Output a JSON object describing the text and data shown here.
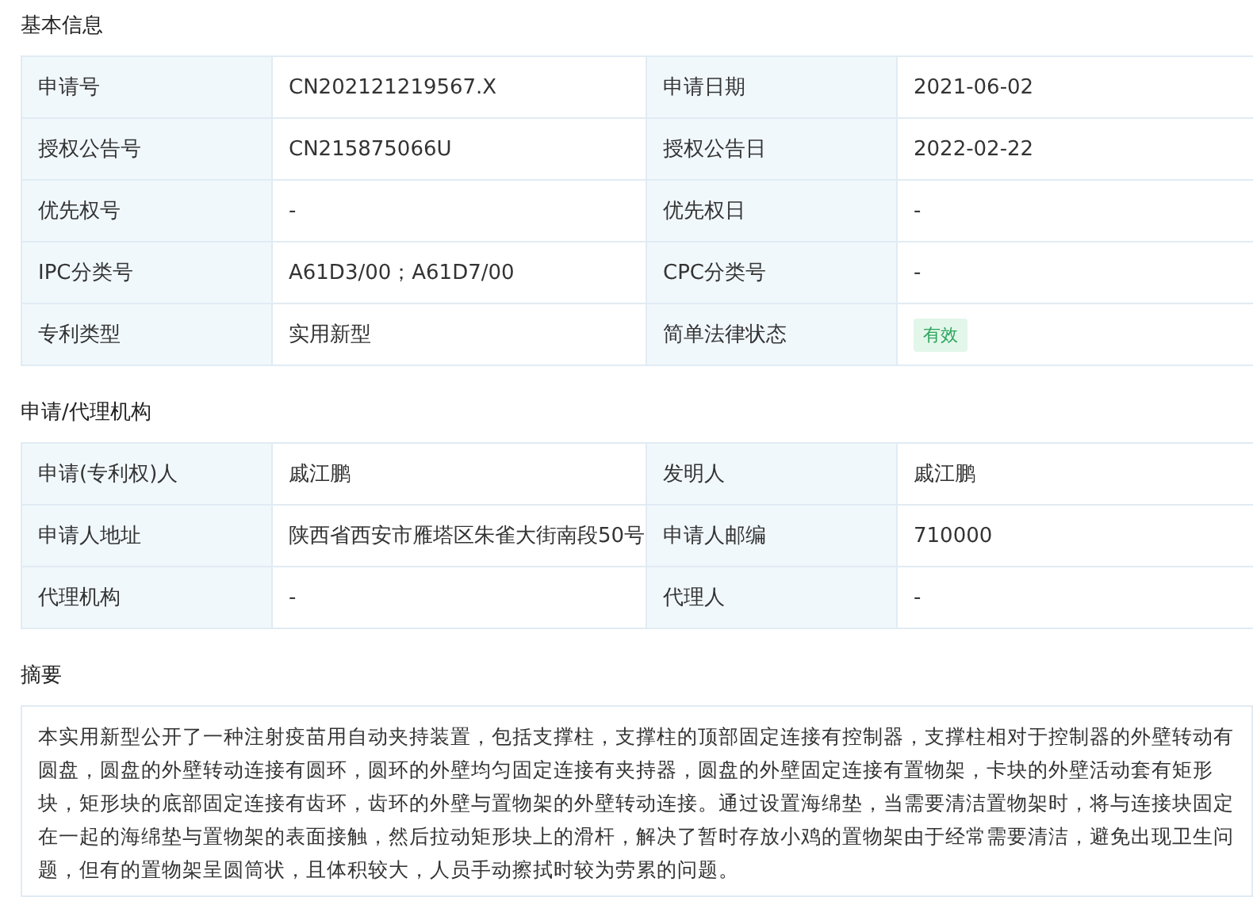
{
  "sections": [
    {
      "title": "基本信息",
      "rows": [
        [
          {
            "label": "申请号",
            "value": "CN202121219567.X",
            "kind": "text"
          },
          {
            "label": "申请日期",
            "value": "2021-06-02",
            "kind": "text"
          }
        ],
        [
          {
            "label": "授权公告号",
            "value": "CN215875066U",
            "kind": "text"
          },
          {
            "label": "授权公告日",
            "value": "2022-02-22",
            "kind": "text"
          }
        ],
        [
          {
            "label": "优先权号",
            "value": "-",
            "kind": "text"
          },
          {
            "label": "优先权日",
            "value": "-",
            "kind": "text"
          }
        ],
        [
          {
            "label": "IPC分类号",
            "value": "A61D3/00；A61D7/00",
            "kind": "text"
          },
          {
            "label": "CPC分类号",
            "value": "-",
            "kind": "text"
          }
        ],
        [
          {
            "label": "专利类型",
            "value": "实用新型",
            "kind": "text"
          },
          {
            "label": "简单法律状态",
            "value": "有效",
            "kind": "badge"
          }
        ]
      ]
    },
    {
      "title": "申请/代理机构",
      "rows": [
        [
          {
            "label": "申请(专利权)人",
            "value": "戚江鹏",
            "kind": "text"
          },
          {
            "label": "发明人",
            "value": "戚江鹏",
            "kind": "text"
          }
        ],
        [
          {
            "label": "申请人地址",
            "value": "陕西省西安市雁塔区朱雀大街南段50号",
            "kind": "text"
          },
          {
            "label": "申请人邮编",
            "value": "710000",
            "kind": "text"
          }
        ],
        [
          {
            "label": "代理机构",
            "value": "-",
            "kind": "text"
          },
          {
            "label": "代理人",
            "value": "-",
            "kind": "text"
          }
        ]
      ]
    }
  ],
  "abstract": {
    "title": "摘要",
    "text": "本实用新型公开了一种注射疫苗用自动夹持装置，包括支撑柱，支撑柱的顶部固定连接有控制器，支撑柱相对于控制器的外壁转动有圆盘，圆盘的外壁转动连接有圆环，圆环的外壁均匀固定连接有夹持器，圆盘的外壁固定连接有置物架，卡块的外壁活动套有矩形块，矩形块的底部固定连接有齿环，齿环的外壁与置物架的外壁转动连接。通过设置海绵垫，当需要清洁置物架时，将与连接块固定在一起的海绵垫与置物架的表面接触，然后拉动矩形块上的滑杆，解决了暂时存放小鸡的置物架由于经常需要清洁，避免出现卫生问题，但有的置物架呈圆筒状，且体积较大，人员手动擦拭时较为劳累的问题。"
  }
}
